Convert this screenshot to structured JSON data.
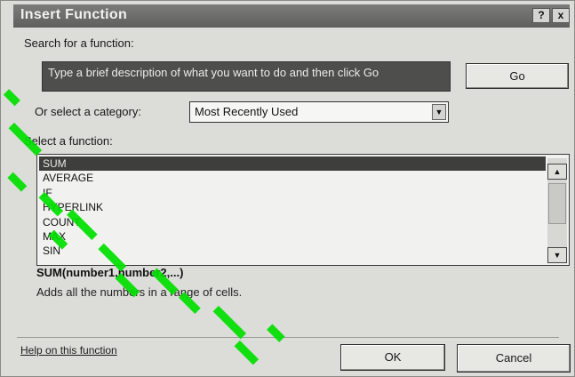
{
  "dialog": {
    "title": "Insert Function",
    "help_glyph": "?",
    "close_glyph": "x"
  },
  "search": {
    "label": "Search for a function:",
    "placeholder": "Type a brief description of what you want to do and then click Go",
    "go_label": "Go"
  },
  "category": {
    "label": "Or select a category:",
    "selected": "Most Recently Used"
  },
  "functions": {
    "label": "Select a function:",
    "items": [
      "SUM",
      "AVERAGE",
      "IF",
      "HYPERLINK",
      "COUNT",
      "MAX",
      "SIN"
    ],
    "selected_index": 0
  },
  "signature": "SUM(number1,number2,...)",
  "description": "Adds all the numbers in a range of cells.",
  "footer": {
    "help_link": "Help on this function",
    "ok_label": "OK",
    "cancel_label": "Cancel"
  },
  "colors": {
    "titlebar": "#6a6a68",
    "selection": "#3e3e3c",
    "watermark": "#00e000"
  },
  "icons": {
    "dropdown": "chevron-down-icon",
    "scroll_up": "scroll-up-icon",
    "scroll_down": "scroll-down-icon"
  }
}
